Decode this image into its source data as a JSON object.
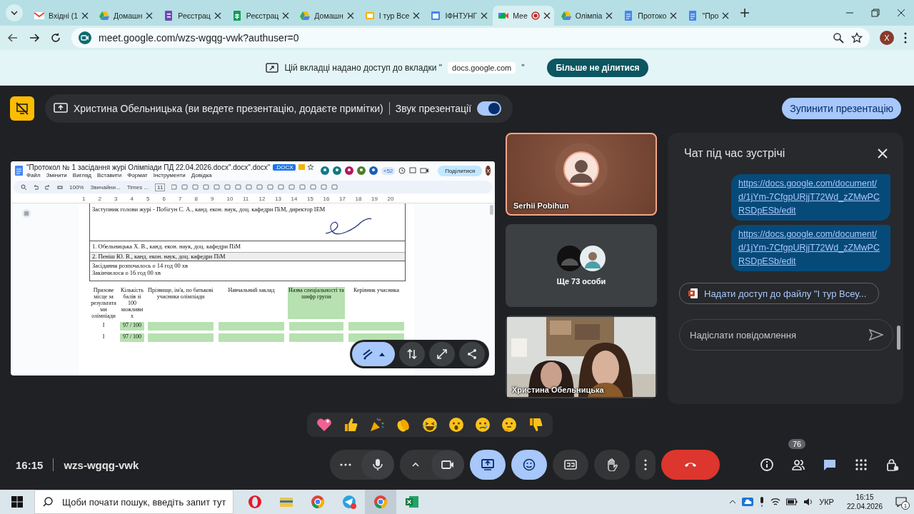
{
  "browser": {
    "tabs": [
      {
        "kind": "gmail",
        "title": "Вхідні (1",
        "selected": false
      },
      {
        "kind": "drive",
        "title": "Домашн",
        "selected": false
      },
      {
        "kind": "forms",
        "title": "Реєстрац",
        "selected": false
      },
      {
        "kind": "sheets",
        "title": "Реєстрац",
        "selected": false
      },
      {
        "kind": "drive",
        "title": "Домашн",
        "selected": false
      },
      {
        "kind": "slides",
        "title": "І тур Все",
        "selected": false
      },
      {
        "kind": "calendar",
        "title": "ІФНТУНГ",
        "selected": false
      },
      {
        "kind": "meet",
        "title": "Mee",
        "selected": true
      },
      {
        "kind": "drive",
        "title": "Олімпіа",
        "selected": false
      },
      {
        "kind": "docs",
        "title": "Протоко",
        "selected": false
      },
      {
        "kind": "docs",
        "title": "\"Про",
        "selected": false
      }
    ],
    "url": "meet.google.com/wzs-wgqg-vwk?authuser=0",
    "profile": "X"
  },
  "share_banner": {
    "text": "Цій вкладці надано доступ до вкладки \"",
    "domain": "docs.google.com",
    "closing": "\"",
    "button": "Більше не ділитися"
  },
  "presenting_bar": {
    "text": "Христина Обельницька (ви ведете презентацію, додаєте примітки)",
    "audio_label": "Звук презентації",
    "audio_on": true,
    "stop_button": "Зупинити презентацію"
  },
  "shared_doc": {
    "title": "\"Протокол № 1 засідання журі Олімпіади ПД 22.04.2026.docx\".docx\".docx\"",
    "badge": ".DOCX",
    "menus": [
      "Файл",
      "Змінити",
      "Вигляд",
      "Вставити",
      "Формат",
      "Інструменти",
      "Довідка"
    ],
    "collaborator_count": "+52",
    "share_button": "Поділитися",
    "user": "X",
    "zoom": "100%",
    "style": "Звичайни...",
    "font": "Times ...",
    "font_size": "11",
    "ruler": [
      "1",
      "2",
      "3",
      "4",
      "5",
      "6",
      "7",
      "8",
      "9",
      "10",
      "11",
      "12",
      "13",
      "14",
      "15",
      "16",
      "17",
      "18",
      "19",
      "20"
    ],
    "signature_block": "Заступник голови журі - Побігун С. А.,  канд. екон. наук, доц. кафедри ПіМ, директор ІЕМ",
    "members": [
      "1.  Обельницька Х. В., канд. екон. наук, доц. кафедри ПіМ",
      "2. Пеніш Ю. В., канд. екон. наук, доц. кафедри ПіМ"
    ],
    "times": [
      "Засідання розпочалось о 14 год 00 хв",
      "Закінчилося о 16 год 00 хв"
    ],
    "table": {
      "columns": [
        "Призове місце за результатами олімпіади",
        "Кількість балів зі 100 можливих",
        "Прізвище, ім'я, по батькові учасника олімпіади",
        "Навчальний заклад",
        "Назва спеціальності та шифр групи",
        "Керівник учасника"
      ],
      "rows": [
        {
          "place": "І",
          "score": "97 / 100"
        },
        {
          "place": "І",
          "score": "97 / 100"
        }
      ]
    }
  },
  "tiles": [
    {
      "kind": "avatar",
      "name": "Serhii Pobihun",
      "speaking": true
    },
    {
      "kind": "others",
      "label": "Ще 73 особи",
      "speaking": false
    },
    {
      "kind": "video",
      "name": "Христина Обельницька",
      "speaking": false
    }
  ],
  "chat": {
    "title": "Чат під час зустрічі",
    "messages": [
      "https://docs.google.com/document/d/1jYm-7CfgpURjjT72Wd_zZMwPCRSDpESb/edit",
      "https://docs.google.com/document/d/1jYm-7CfgpURjjT72Wd_zZMwPCRSDpESb/edit"
    ],
    "file_suggestion": "Надати доступ до файлу \"І тур Всеу...",
    "input": {
      "placeholder": "Надіслати повідомлення"
    }
  },
  "meeting": {
    "time": "16:15",
    "code": "wzs-wgqg-vwk"
  },
  "controls": [
    {
      "kind": "more",
      "active": false
    },
    {
      "kind": "mic",
      "active": false
    },
    {
      "kind": "chevron",
      "active": false
    },
    {
      "kind": "camera",
      "active": false
    },
    {
      "kind": "present",
      "active": true
    },
    {
      "kind": "emoji",
      "active": true
    },
    {
      "kind": "captions",
      "active": false
    },
    {
      "kind": "hand",
      "active": false
    },
    {
      "kind": "menu",
      "active": false
    },
    {
      "kind": "hangup",
      "active": false
    }
  ],
  "side_controls": [
    {
      "kind": "info",
      "active": false
    },
    {
      "kind": "people",
      "active": false,
      "badge": "76"
    },
    {
      "kind": "chat",
      "active": true
    },
    {
      "kind": "apps",
      "active": false
    },
    {
      "kind": "lock",
      "active": false
    }
  ],
  "taskbar": {
    "search": {
      "placeholder": "Щоби почати пошук, введіть запит тут"
    },
    "language": "УКР",
    "time": "16:15",
    "date": "22.04.2026",
    "notifications": "1"
  }
}
